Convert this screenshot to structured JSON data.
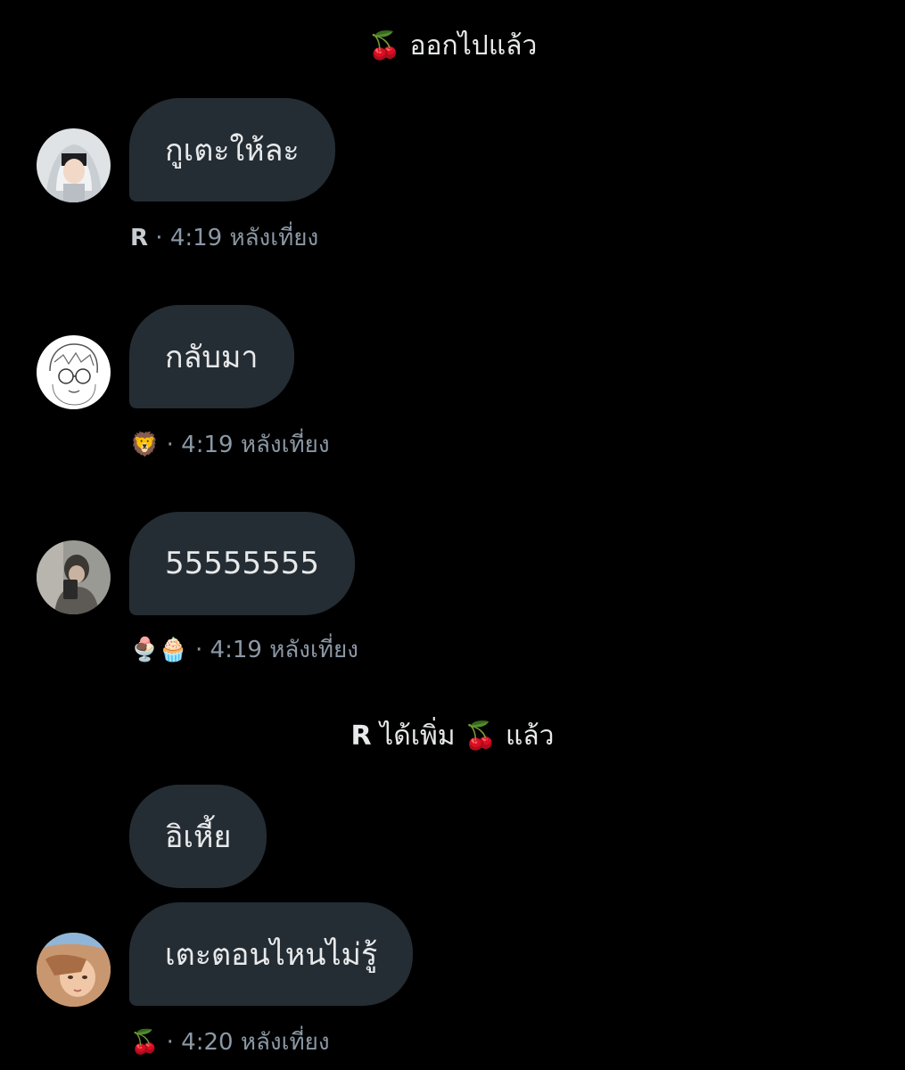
{
  "system_messages": [
    {
      "emoji": "🍒",
      "text": "ออกไปแล้ว"
    },
    {
      "actor": "ꓣ",
      "verb": "ได้เพิ่ม",
      "emoji": "🍒",
      "suffix": "แล้ว"
    }
  ],
  "messages": [
    {
      "text": "กูเตะให้ละ",
      "sender": "ꓣ",
      "time": "4:19 หลังเที่ยง",
      "avatar": "avatar-hoodie-person"
    },
    {
      "text": "กลับมา",
      "sender": "🦁",
      "time": "4:19 หลังเที่ยง",
      "avatar": "avatar-sketch-drawing"
    },
    {
      "text": "55555555",
      "sender": "🍨🧁",
      "time": "4:19 หลังเที่ยง",
      "avatar": "avatar-mirror-selfie"
    },
    {
      "text": "อิเหี้ย"
    },
    {
      "text": "เตะตอนไหนไม่รู้",
      "sender": "🍒",
      "time": "4:20 หลังเที่ยง",
      "avatar": "avatar-portrait-person"
    }
  ],
  "colors": {
    "background": "#000000",
    "bubble": "#252d34",
    "text": "#e7e9ea",
    "meta": "#8b98a5"
  }
}
